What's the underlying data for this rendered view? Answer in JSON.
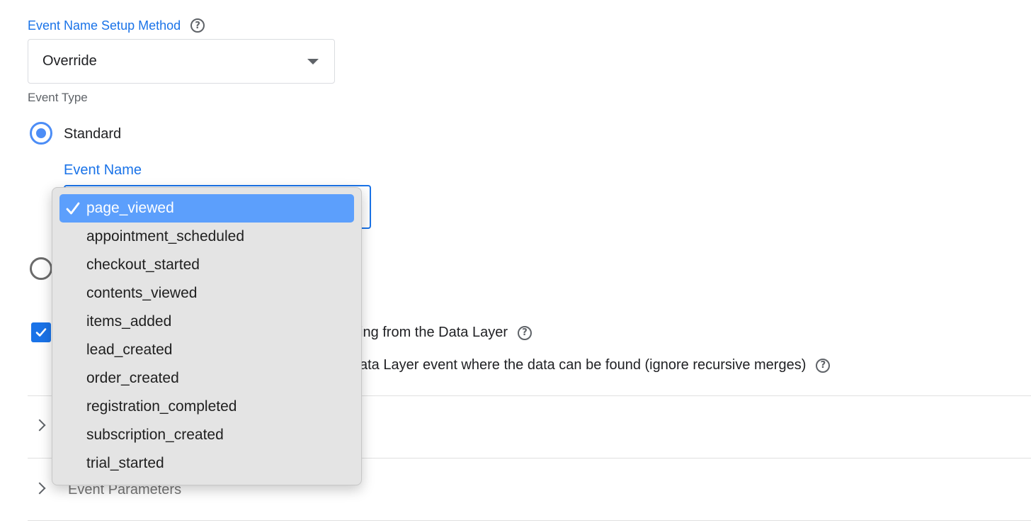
{
  "event_name_setup": {
    "label": "Event Name Setup Method",
    "help_icon": "question-circle-icon",
    "selected_value": "Override"
  },
  "event_type": {
    "label": "Event Type",
    "standard_label": "Standard",
    "standard_checked": true
  },
  "event_name_field": {
    "label": "Event Name"
  },
  "dropdown": {
    "check_icon": "checkmark-icon",
    "selected_index": 0,
    "options": [
      "page_viewed",
      "appointment_scheduled",
      "checkout_started",
      "contents_viewed",
      "items_added",
      "lead_created",
      "order_created",
      "registration_completed",
      "subscription_created",
      "trial_started"
    ]
  },
  "data_layer": {
    "checkbox_checked": true,
    "line1_visible_text": "ing from the Data Layer",
    "line2_visible_text": "ata Layer event where the data can be found (ignore recursive merges)"
  },
  "sections": {
    "event_parameters_label": "Event Parameters"
  },
  "colors": {
    "accent": "#1a73e8",
    "selected_item": "#5c9ffc",
    "menu_background": "#e4e4e4"
  }
}
